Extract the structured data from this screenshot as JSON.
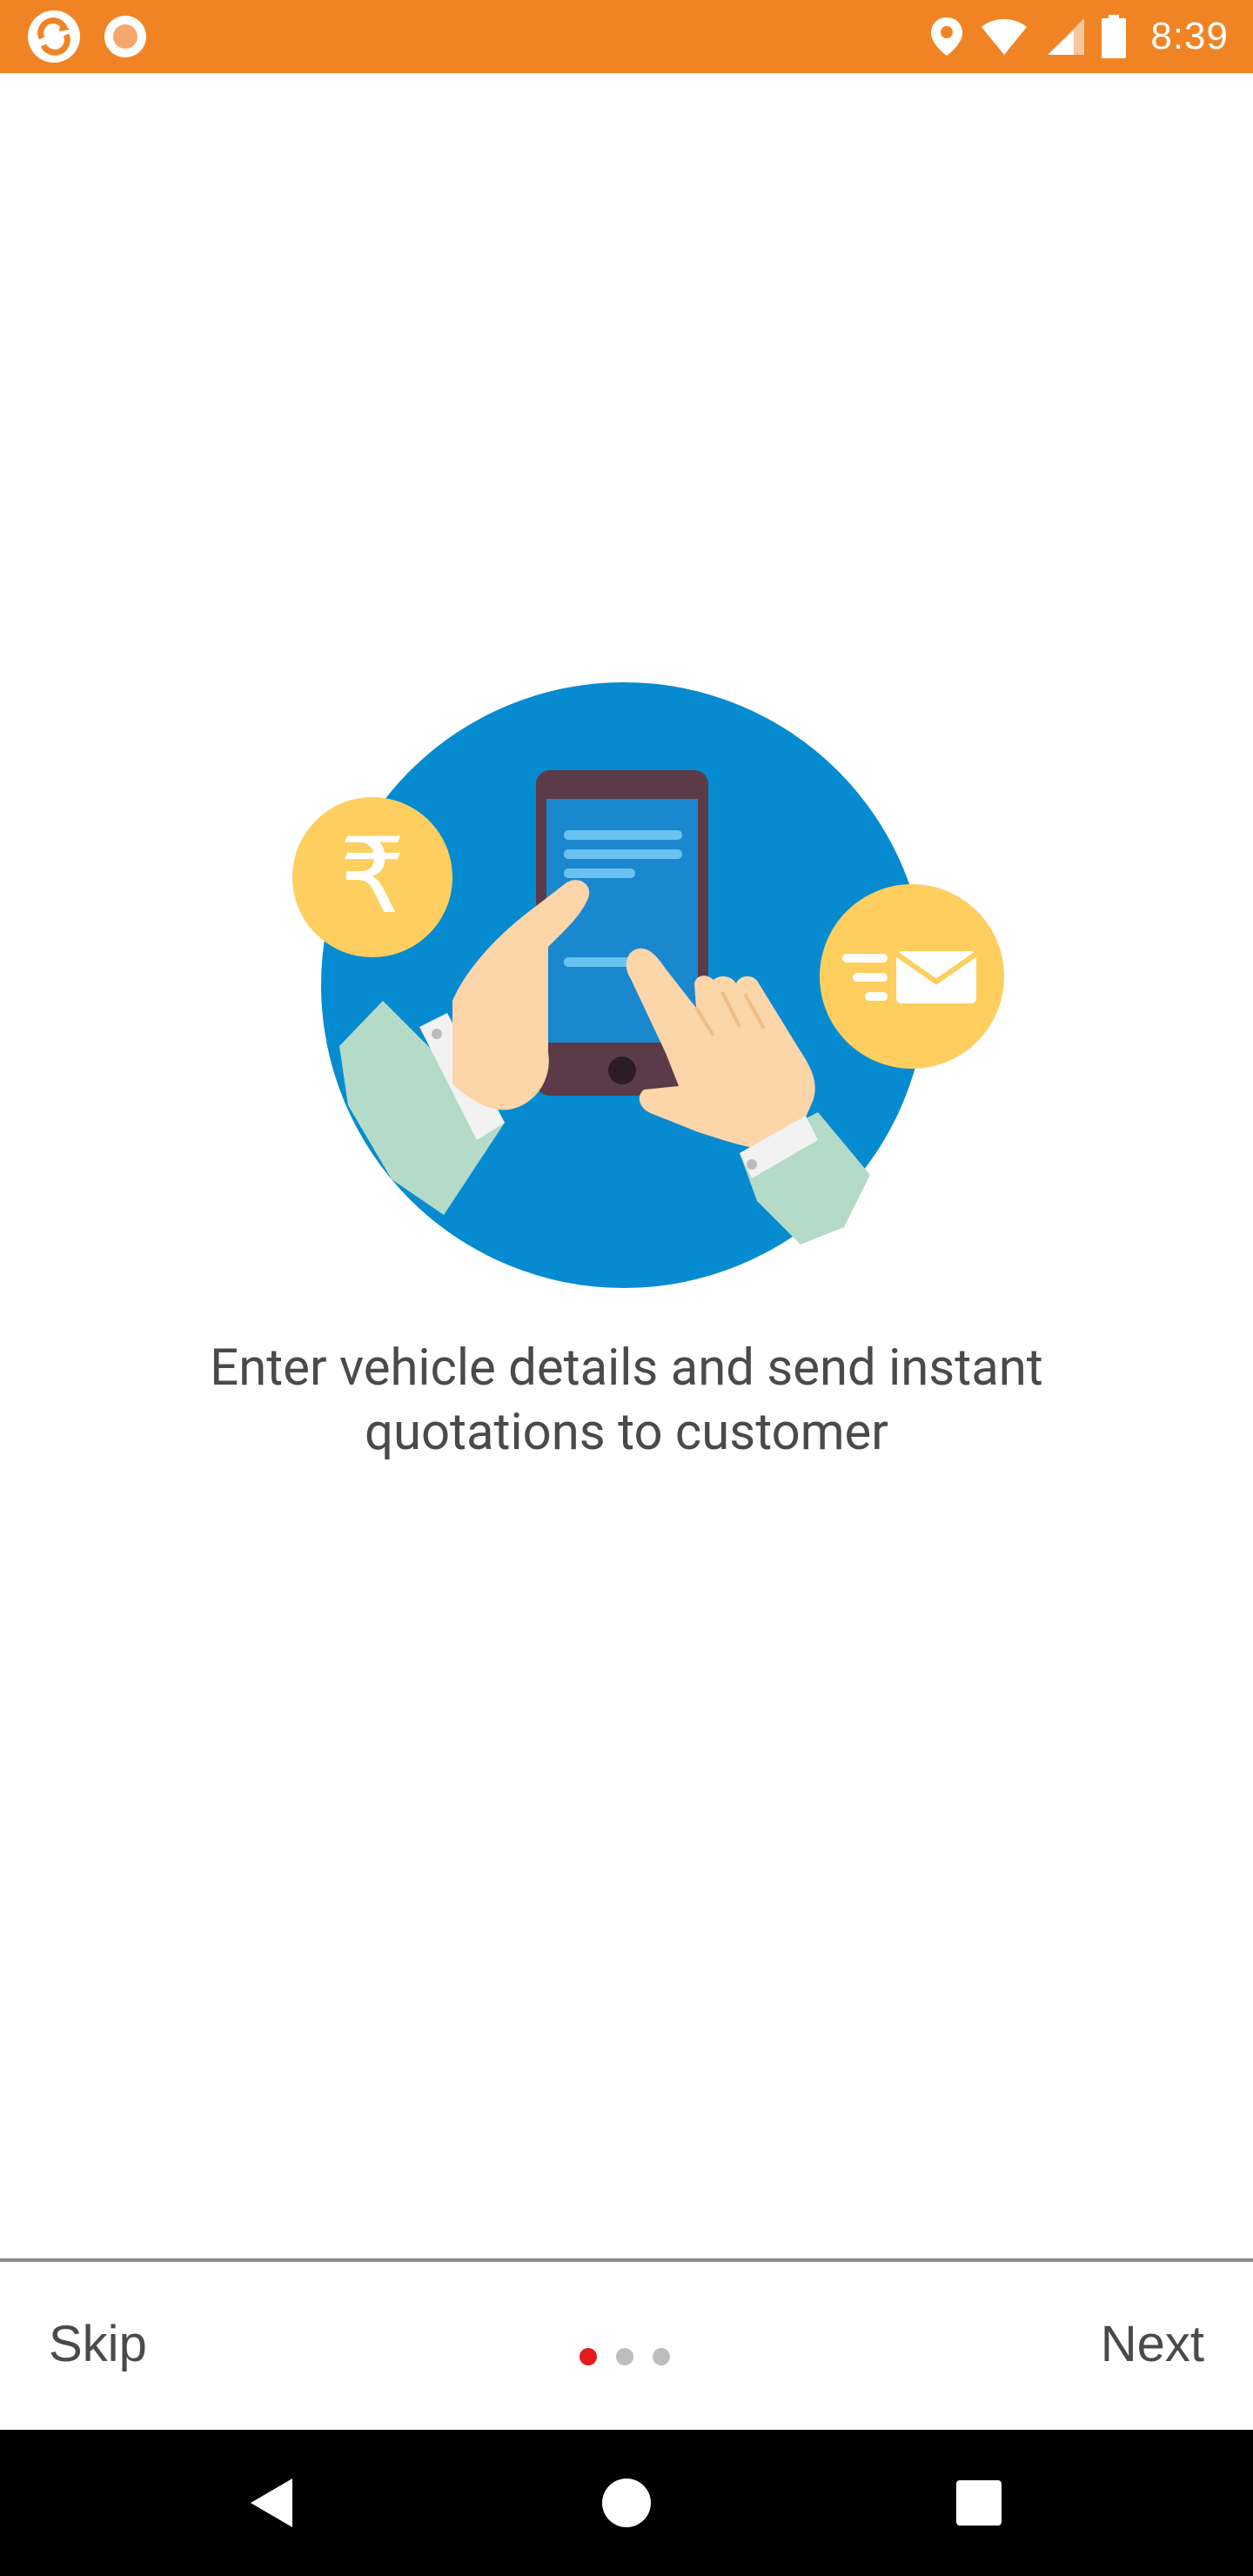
{
  "status_bar": {
    "time": "8:39",
    "left_icons": [
      "sync-app-icon",
      "record-icon"
    ],
    "right_icons": [
      "location-icon",
      "wifi-icon",
      "signal-icon",
      "battery-icon"
    ],
    "background_color": "#f08424"
  },
  "onboarding": {
    "headline_line1": "Enter vehicle details and send instant",
    "headline_line2": "quotations to customer",
    "illustration": "phone-quotation-illustration",
    "rupee_symbol": "₹"
  },
  "footer": {
    "skip_label": "Skip",
    "next_label": "Next",
    "page_count": 3,
    "active_page": 1,
    "active_dot_color": "#e51b1b"
  },
  "nav_bar": {
    "buttons": [
      "back-icon",
      "home-icon",
      "recents-icon"
    ]
  }
}
